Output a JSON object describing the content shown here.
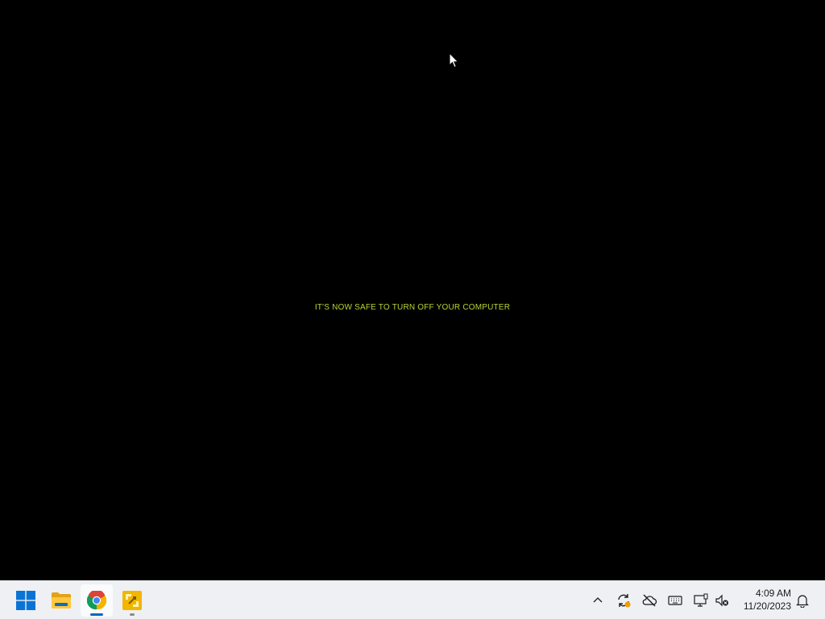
{
  "screen": {
    "message": "IT'S NOW SAFE TO TURN OFF YOUR COMPUTER"
  },
  "colors": {
    "message": "#b7d434",
    "taskbar_bg": "#eef0f3",
    "start_blue": "#0a74d6"
  },
  "taskbar": {
    "apps": [
      {
        "icon": "windows-start-icon"
      },
      {
        "icon": "file-explorer-icon"
      },
      {
        "icon": "chrome-icon",
        "active": true
      },
      {
        "icon": "app-yellow-icon",
        "running": true
      }
    ],
    "tray": [
      {
        "icon": "chevron-up-icon"
      },
      {
        "icon": "sync-icon"
      },
      {
        "icon": "cloud-off-icon"
      },
      {
        "icon": "keyboard-icon"
      },
      {
        "icon": "display-icon"
      },
      {
        "icon": "speaker-muted-icon"
      }
    ],
    "time": "4:09 AM",
    "date": "11/20/2023"
  }
}
